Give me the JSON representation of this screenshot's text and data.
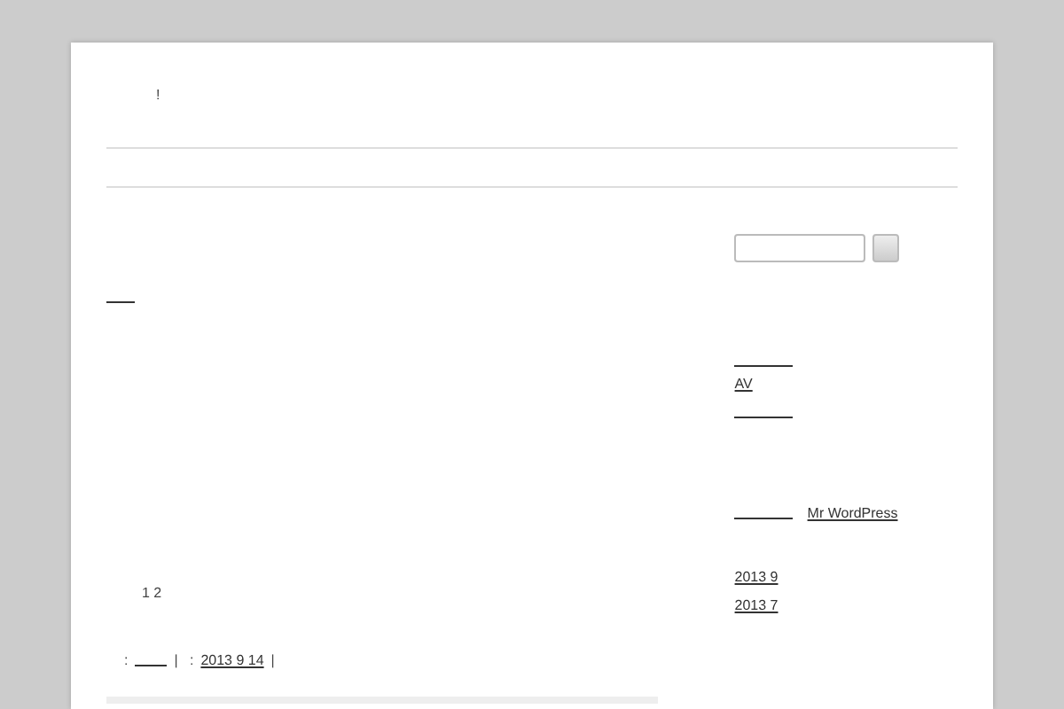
{
  "header": {
    "site_title": "!"
  },
  "post": {
    "pagination": "1 2",
    "meta": [
      {
        "kind": "text",
        "text": ":"
      },
      {
        "kind": "blank-link"
      },
      {
        "kind": "text",
        "text": "|   :"
      },
      {
        "kind": "link",
        "text": "2013 9 14"
      },
      {
        "kind": "text",
        "text": "|"
      }
    ]
  },
  "sidebar": {
    "recent": [
      {
        "kind": "blank-link"
      },
      {
        "kind": "link",
        "text": "AV"
      },
      {
        "kind": "blank-link"
      }
    ],
    "comments": [
      {
        "kind": "blank-link"
      },
      {
        "kind": "link",
        "text": "Mr WordPress"
      }
    ],
    "archives": [
      {
        "text": "2013 9"
      },
      {
        "text": "2013 7"
      }
    ]
  }
}
